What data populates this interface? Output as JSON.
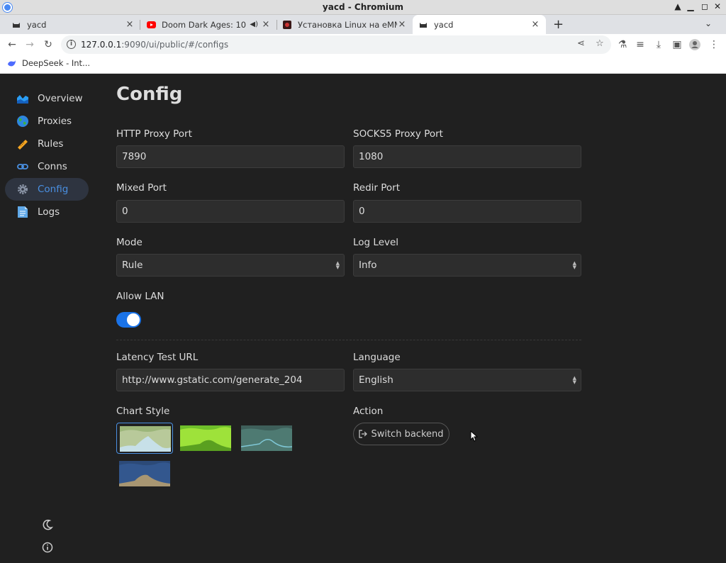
{
  "window": {
    "title": "yacd - Chromium"
  },
  "tabs": [
    {
      "label": "yacd",
      "active": false
    },
    {
      "label": "Doom Dark Ages: 10 Th",
      "active": false
    },
    {
      "label": "Установка Linux на eMMC",
      "active": false
    },
    {
      "label": "yacd",
      "active": true
    }
  ],
  "address": {
    "host": "127.0.0.1",
    "path": ":9090/ui/public/#/configs"
  },
  "bookmarks": [
    {
      "label": "DeepSeek - Int..."
    }
  ],
  "sidebar": {
    "items": [
      {
        "label": "Overview",
        "icon": "overview-chart-icon"
      },
      {
        "label": "Proxies",
        "icon": "globe-icon"
      },
      {
        "label": "Rules",
        "icon": "ruler-icon"
      },
      {
        "label": "Conns",
        "icon": "link-icon"
      },
      {
        "label": "Config",
        "icon": "gear-icon",
        "active": true
      },
      {
        "label": "Logs",
        "icon": "document-icon"
      }
    ]
  },
  "page": {
    "title": "Config",
    "http_port": {
      "label": "HTTP Proxy Port",
      "value": "7890"
    },
    "socks_port": {
      "label": "SOCKS5 Proxy Port",
      "value": "1080"
    },
    "mixed_port": {
      "label": "Mixed Port",
      "value": "0"
    },
    "redir_port": {
      "label": "Redir Port",
      "value": "0"
    },
    "mode": {
      "label": "Mode",
      "value": "Rule"
    },
    "log_level": {
      "label": "Log Level",
      "value": "Info"
    },
    "allow_lan": {
      "label": "Allow LAN",
      "enabled": true
    },
    "latency_url": {
      "label": "Latency Test URL",
      "value": "http://www.gstatic.com/generate_204"
    },
    "language": {
      "label": "Language",
      "value": "English"
    },
    "chart_style": {
      "label": "Chart Style",
      "selected_index": 0
    },
    "action": {
      "label": "Action",
      "button": "Switch backend"
    }
  },
  "colors": {
    "accent": "#4a90e2",
    "toggle_on": "#1a73e8",
    "background": "#202020"
  }
}
